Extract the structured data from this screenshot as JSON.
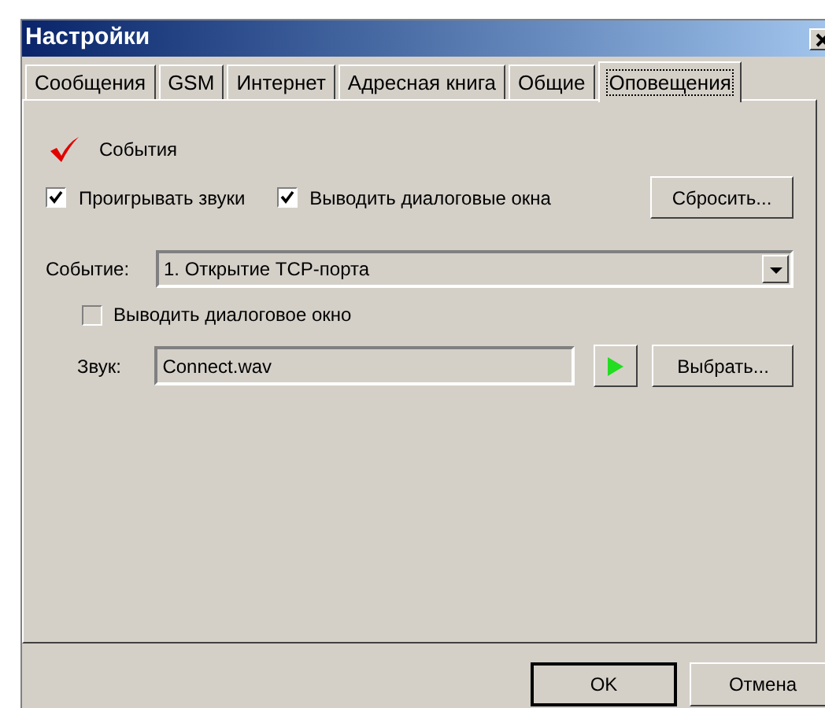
{
  "window": {
    "title": "Настройки"
  },
  "tabs": [
    {
      "label": "Сообщения",
      "selected": false
    },
    {
      "label": "GSM",
      "selected": false
    },
    {
      "label": "Интернет",
      "selected": false
    },
    {
      "label": "Адресная книга",
      "selected": false
    },
    {
      "label": "Общие",
      "selected": false
    },
    {
      "label": "Оповещения",
      "selected": true
    }
  ],
  "events_header": "События",
  "options": [
    {
      "label": "Проигрывать звуки",
      "checked": true
    },
    {
      "label": "Выводить диалоговые окна",
      "checked": true
    }
  ],
  "reset_button": "Сбросить...",
  "event": {
    "label": "Событие:",
    "value": "1. Открытие TCP-порта"
  },
  "show_dialog": {
    "label": "Выводить диалоговое окно",
    "checked": false
  },
  "sound": {
    "label": "Звук:",
    "value": "Connect.wav",
    "browse_button": "Выбрать..."
  },
  "buttons": [
    "OK",
    "Отмена"
  ]
}
